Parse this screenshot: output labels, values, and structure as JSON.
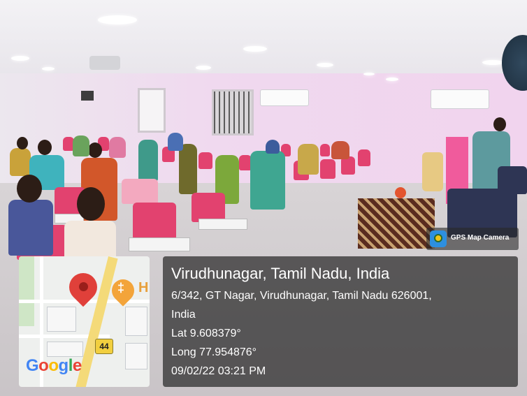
{
  "photo": {
    "description_icon": "classroom-photo"
  },
  "badge": {
    "label": "GPS Map Camera",
    "icon": "map-camera-icon"
  },
  "map": {
    "road_label": "44",
    "brand_letters": [
      "G",
      "o",
      "o",
      "g",
      "l",
      "e"
    ],
    "brand_colors": [
      "#4285F4",
      "#EA4335",
      "#FBBC05",
      "#4285F4",
      "#34A853",
      "#EA4335"
    ],
    "poi_letter": "H",
    "pin_color": "#e0403a",
    "poi_color": "#f3a43a"
  },
  "location": {
    "title": "Virudhunagar, Tamil Nadu, India",
    "address_line1": "6/342, GT Nagar, Virudhunagar, Tamil Nadu 626001,",
    "address_line2": "India",
    "lat": "Lat 9.608379°",
    "long": "Long 77.954876°",
    "datetime": "09/02/22 03:21 PM"
  }
}
